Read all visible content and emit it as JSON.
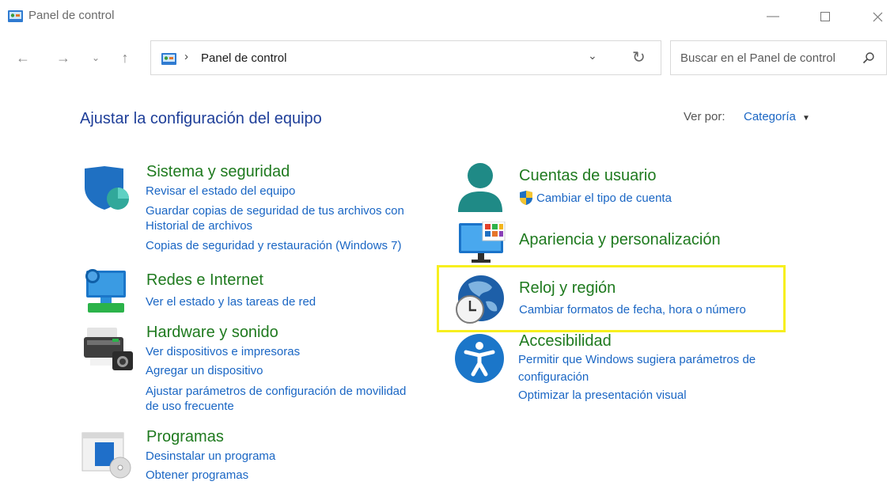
{
  "window": {
    "title": "Panel de control"
  },
  "address_bar": {
    "path": "Panel de control"
  },
  "search": {
    "placeholder": "Buscar en el Panel de control"
  },
  "header": {
    "title": "Ajustar la configuración del equipo",
    "view_by_label": "Ver por:",
    "view_by_value": "Categoría"
  },
  "categories": {
    "system": {
      "title": "Sistema y seguridad",
      "links": [
        "Revisar el estado del equipo",
        "Guardar copias de seguridad de tus archivos con",
        "Historial de archivos",
        "Copias de seguridad y restauración (Windows 7)"
      ]
    },
    "network": {
      "title": "Redes e Internet",
      "links": [
        "Ver el estado y las tareas de red"
      ]
    },
    "hardware": {
      "title": "Hardware y sonido",
      "links": [
        "Ver dispositivos e impresoras",
        "Agregar un dispositivo",
        "Ajustar parámetros de configuración de movilidad",
        "de uso frecuente"
      ]
    },
    "programs": {
      "title": "Programas",
      "links": [
        "Desinstalar un programa",
        "Obtener programas"
      ]
    },
    "users": {
      "title": "Cuentas de usuario",
      "links": [
        "Cambiar el tipo de cuenta"
      ]
    },
    "appearance": {
      "title": "Apariencia y personalización",
      "links": []
    },
    "clock": {
      "title": "Reloj y región",
      "links": [
        "Cambiar formatos de fecha, hora o número"
      ]
    },
    "access": {
      "title": "Accesibilidad",
      "links": [
        "Permitir que Windows sugiera parámetros de",
        "configuración",
        "Optimizar la presentación visual"
      ]
    }
  },
  "colors": {
    "link": "#1a66c4",
    "category_title": "#1f7a1f",
    "page_title": "#1f3f99",
    "highlight": "#f7ef1e"
  }
}
